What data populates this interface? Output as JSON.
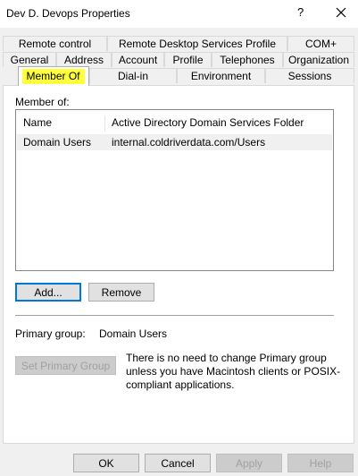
{
  "window": {
    "title": "Dev D. Devops Properties",
    "help_glyph": "?"
  },
  "tabs": {
    "row1": [
      "Remote control",
      "Remote Desktop Services Profile",
      "COM+"
    ],
    "row2": [
      "General",
      "Address",
      "Account",
      "Profile",
      "Telephones",
      "Organization"
    ],
    "row3": [
      "Member Of",
      "Dial-in",
      "Environment",
      "Sessions"
    ],
    "active": "Member Of",
    "highlight_color": "#ffff3c"
  },
  "member_of": {
    "label": "Member of:",
    "columns": [
      "Name",
      "Active Directory Domain Services Folder"
    ],
    "rows": [
      {
        "name": "Domain Users",
        "folder": "internal.coldriverdata.com/Users"
      }
    ]
  },
  "buttons": {
    "add": "Add...",
    "remove": "Remove",
    "set_primary": "Set Primary Group",
    "ok": "OK",
    "cancel": "Cancel",
    "apply": "Apply",
    "help": "Help"
  },
  "primary_group": {
    "label": "Primary group:",
    "value": "Domain Users",
    "note": "There is no need to change Primary group unless you have Macintosh clients or POSIX-compliant applications."
  }
}
